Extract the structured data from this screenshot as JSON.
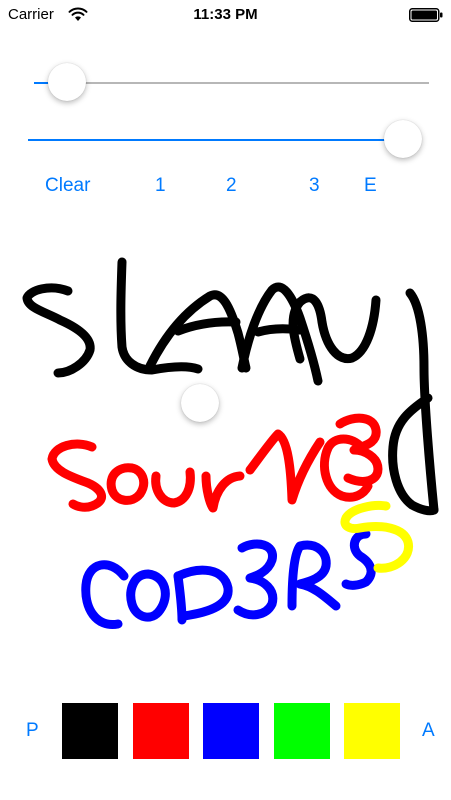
{
  "status_bar": {
    "carrier": "Carrier",
    "time": "11:33 PM",
    "wifi_icon": "wifi-icon",
    "battery_icon": "battery-icon"
  },
  "sliders": {
    "top": {
      "value": 0.0
    },
    "bottom": {
      "value": 1.0
    }
  },
  "toolbar": {
    "clear_label": "Clear",
    "brush1_label": "1",
    "brush2_label": "2",
    "brush3_label": "3",
    "eraser_label": "E"
  },
  "drawing": {
    "strokes": [
      {
        "color": "#000000",
        "text": "SLAAY"
      },
      {
        "color": "#ff0000",
        "text": "SOURC3"
      },
      {
        "color": "#0000ff",
        "text": "COD3RS"
      },
      {
        "color": "#ffff00",
        "text": "S"
      }
    ]
  },
  "palette": {
    "left_label": "P",
    "right_label": "A",
    "colors": [
      {
        "name": "black",
        "hex": "#000000"
      },
      {
        "name": "red",
        "hex": "#ff0000"
      },
      {
        "name": "blue",
        "hex": "#0000ff"
      },
      {
        "name": "green",
        "hex": "#00ff00"
      },
      {
        "name": "yellow",
        "hex": "#ffff00"
      }
    ]
  },
  "accent_color": "#007aff"
}
